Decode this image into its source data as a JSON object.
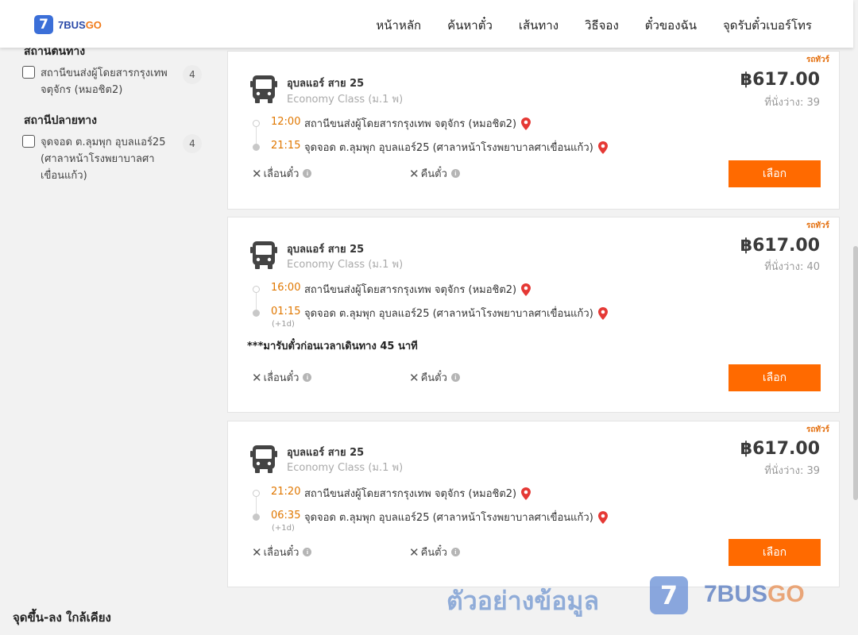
{
  "header": {
    "logo_mark": "7",
    "logo_text_a": "7BUS",
    "logo_text_b": "GO",
    "nav": [
      "หน้าหลัก",
      "ค้นหาตั๋ว",
      "เส้นทาง",
      "วิธีจอง",
      "ตั๋วของฉัน",
      "จุดรับตั๋วเบอร์โทร"
    ]
  },
  "sidebar": {
    "origin_title": "สถานีต้นทาง",
    "origin_option": {
      "label": "สถานีขนส่งผู้โดยสารกรุงเทพ จตุจักร (หมอชิต2)",
      "count": "4"
    },
    "destination_title": "สถานีปลายทาง",
    "destination_option": {
      "label": "จุดจอด ต.ลุมพุก อุบลแอร์25 (ศาลาหน้าโรงพยาบาลศาเขื่อนแก้ว)",
      "count": "4"
    },
    "nearby_title": "จุดขึ้น-ลง ใกล้เคียง"
  },
  "trips": [
    {
      "tag": "รถทัวร์",
      "company": "อุบลแอร์ สาย 25",
      "class": "Economy Class (ม.1 พ)",
      "price": "฿617.00",
      "seats": "ที่นั่งว่าง: 39",
      "depart_time": "12:00",
      "depart_stop": "สถานีขนส่งผู้โดยสารกรุงเทพ จตุจักร (หมอชิต2)",
      "arrive_time": "21:15",
      "arrive_stop": "จุดจอด ต.ลุมพุก อุบลแอร์25 (ศาลาหน้าโรงพยาบาลศาเขื่อนแก้ว)",
      "reschedule": "เลื่อนตั๋ว",
      "refund": "คืนตั๋ว",
      "select": "เลือก"
    },
    {
      "tag": "รถทัวร์",
      "company": "อุบลแอร์ สาย 25",
      "class": "Economy Class (ม.1 พ)",
      "price": "฿617.00",
      "seats": "ที่นั่งว่าง: 40",
      "depart_time": "16:00",
      "depart_stop": "สถานีขนส่งผู้โดยสารกรุงเทพ จตุจักร (หมอชิต2)",
      "arrive_time": "01:15",
      "next_day": "(+1d)",
      "arrive_stop": "จุดจอด ต.ลุมพุก อุบลแอร์25 (ศาลาหน้าโรงพยาบาลศาเขื่อนแก้ว)",
      "note": "***มารับตั๋วก่อนเวลาเดินทาง 45 นาที",
      "reschedule": "เลื่อนตั๋ว",
      "refund": "คืนตั๋ว",
      "select": "เลือก"
    },
    {
      "tag": "รถทัวร์",
      "company": "อุบลแอร์ สาย 25",
      "class": "Economy Class (ม.1 พ)",
      "price": "฿617.00",
      "seats": "ที่นั่งว่าง: 39",
      "depart_time": "21:20",
      "depart_stop": "สถานีขนส่งผู้โดยสารกรุงเทพ จตุจักร (หมอชิต2)",
      "arrive_time": "06:35",
      "next_day": "(+1d)",
      "arrive_stop": "จุดจอด ต.ลุมพุก อุบลแอร์25 (ศาลาหน้าโรงพยาบาลศาเขื่อนแก้ว)",
      "reschedule": "เลื่อนตั๋ว",
      "refund": "คืนตั๋ว",
      "select": "เลือก"
    }
  ],
  "watermark": {
    "text": "ตัวอย่างข้อมูล",
    "logo_mark": "7",
    "brand_a": "7BUS",
    "brand_b": "GO"
  },
  "colors": {
    "accent": "#ff6a00",
    "time": "#e07700",
    "brand_blue": "#3b6fd8",
    "pin": "#e53935"
  }
}
